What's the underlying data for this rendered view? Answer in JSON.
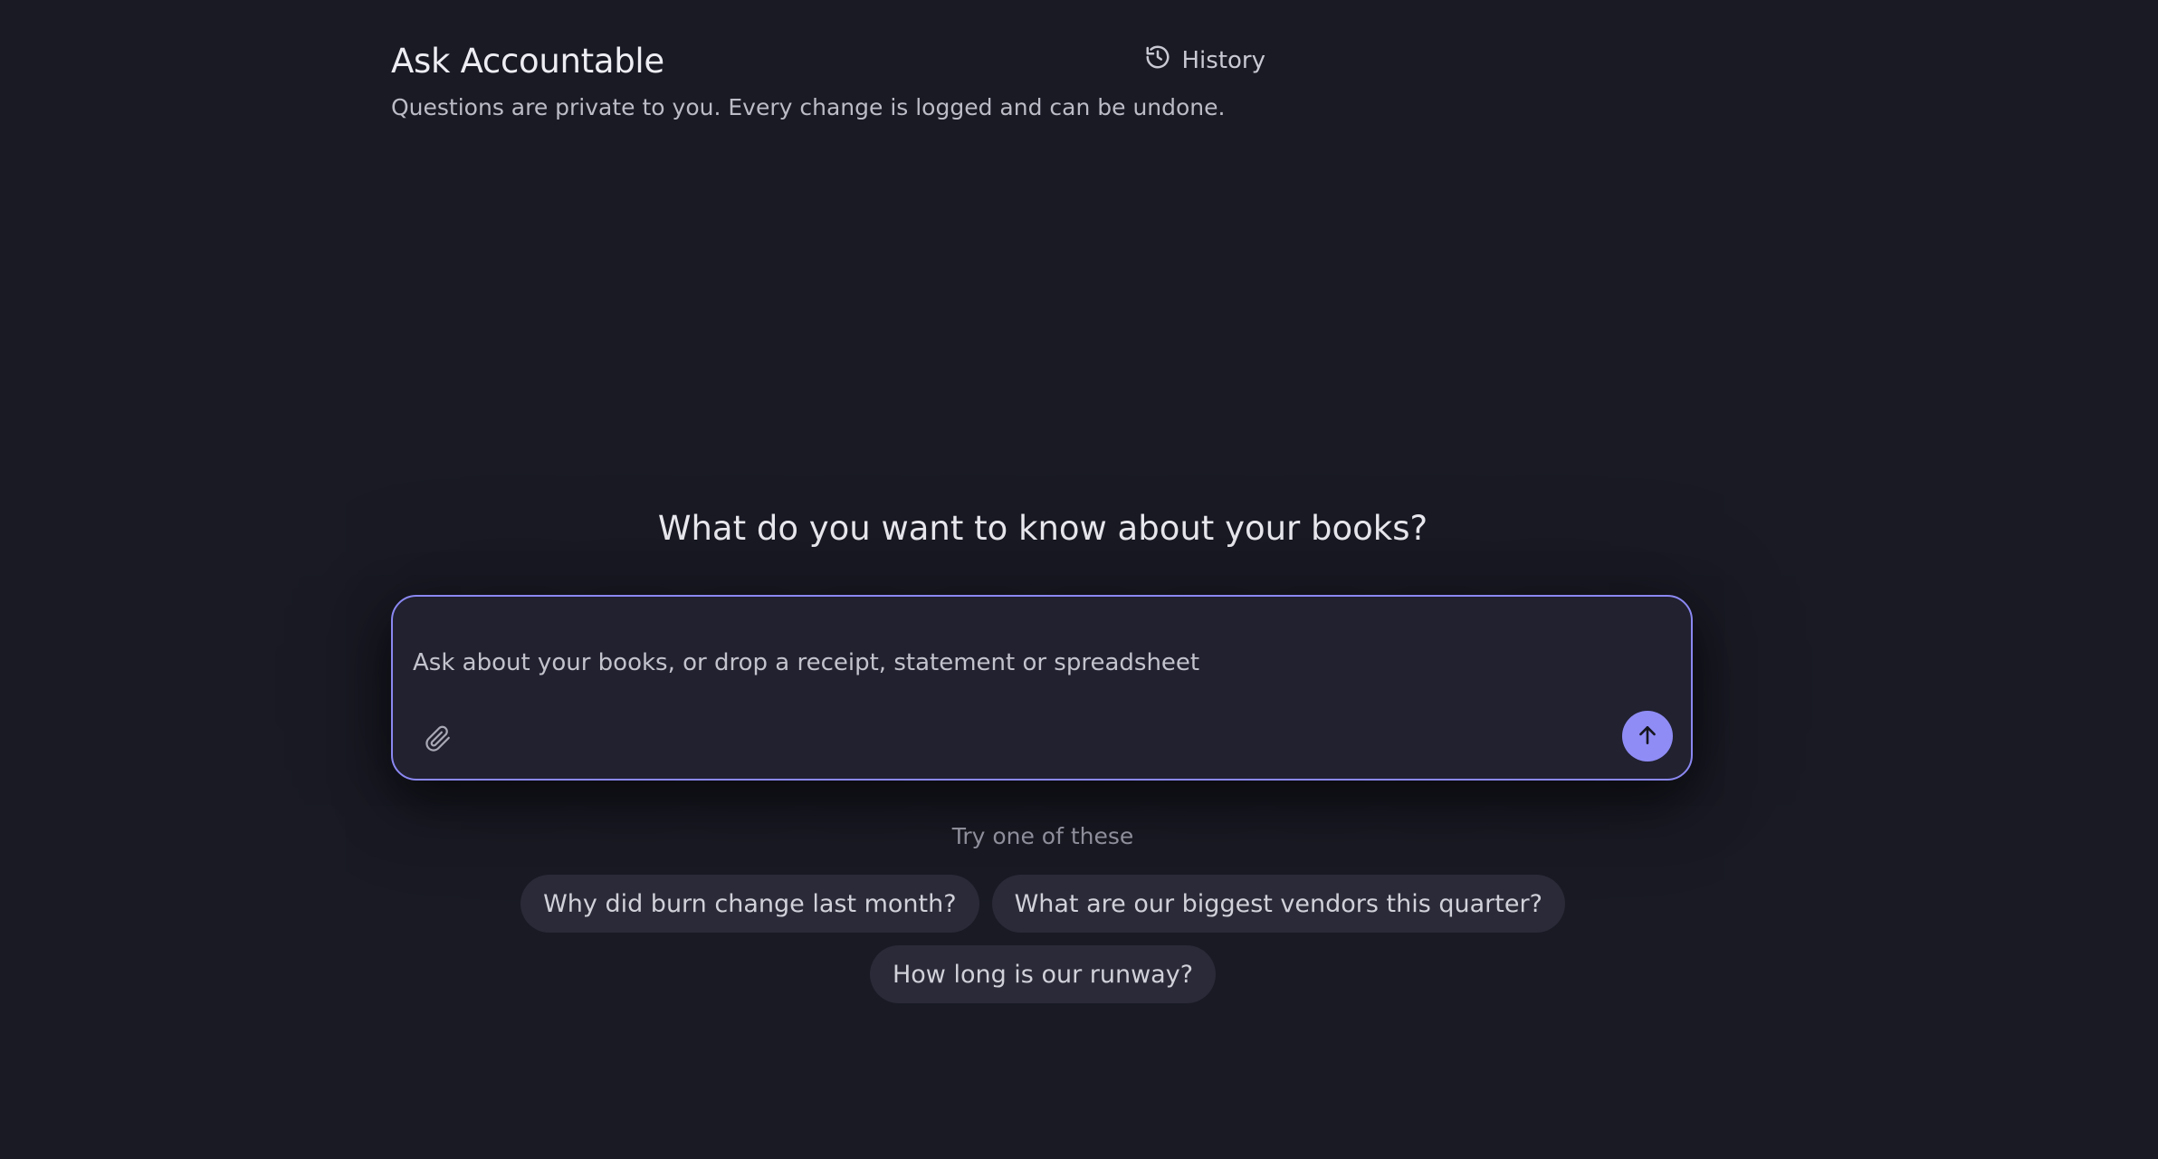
{
  "header": {
    "title": "Ask Accountable",
    "subtitle": "Questions are private to you. Every change is logged and can be undone.",
    "history_label": "History"
  },
  "hero": {
    "prompt": "What do you want to know about your books?"
  },
  "composer": {
    "value": "",
    "placeholder": "Ask about your books, or drop a receipt, statement or spreadsheet",
    "attach_icon": "paperclip-icon",
    "send_icon": "arrow-up-icon"
  },
  "suggestions": {
    "label": "Try one of these",
    "items": [
      "Why did burn change last month?",
      "What are our biggest vendors this quarter?",
      "How long is our runway?"
    ]
  },
  "colors": {
    "background": "#191a24",
    "accent": "#8f8cf5",
    "composer_bg": "#212130",
    "chip_bg": "#2a2a38"
  }
}
